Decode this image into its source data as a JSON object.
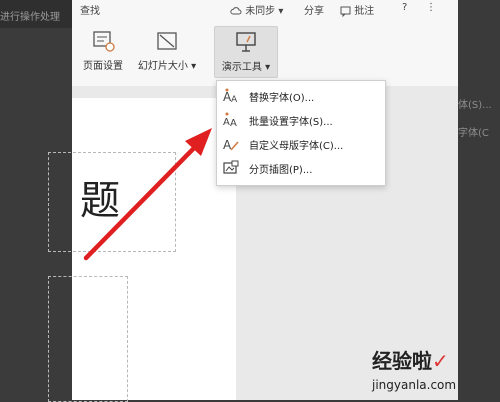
{
  "left_panel": {
    "partial_label": "进行操作处理"
  },
  "topbar": {
    "partial_title": "查找",
    "sync_label": "未同步",
    "share_label": "分享",
    "comment_label": "批注",
    "help_label": "?",
    "more_label": "⋮"
  },
  "ribbon": {
    "page_setup": "页面设置",
    "slide_size": "幻灯片大小",
    "presentation_tools": "演示工具"
  },
  "menu": {
    "items": [
      {
        "label": "替换字体(O)..."
      },
      {
        "label": "批量设置字体(S)..."
      },
      {
        "label": "自定义母版字体(C)..."
      },
      {
        "label": "分页插图(P)..."
      }
    ]
  },
  "slide": {
    "title_partial": "题"
  },
  "right_panel": {
    "items": [
      {
        "label": "体(S)..."
      },
      {
        "label": "字体(C"
      }
    ]
  },
  "watermark": {
    "text_cn": "经验啦",
    "text_en": "jingyanla.com",
    "check": "✓"
  }
}
